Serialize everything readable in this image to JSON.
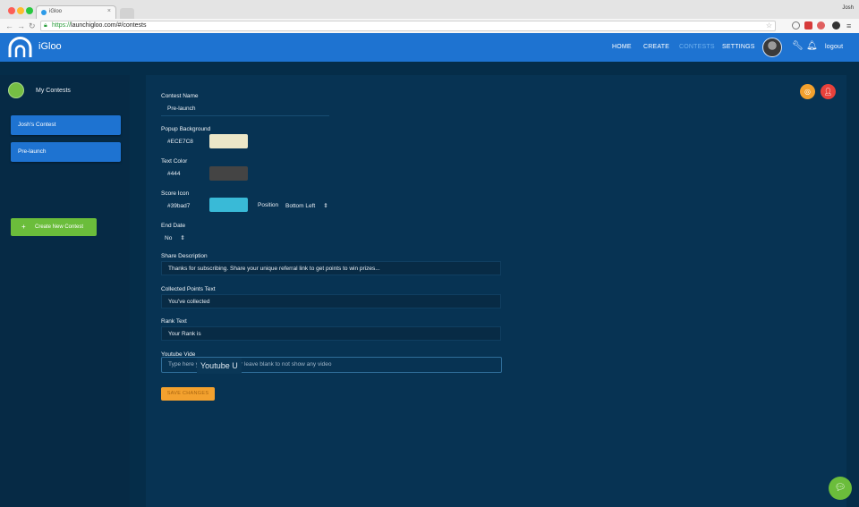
{
  "browser": {
    "tab_title": "iGloo",
    "profile": "Josh",
    "url_scheme": "https://",
    "url_rest": "launchigloo.com/#/contests"
  },
  "topbar": {
    "brand": "iGloo",
    "nav": [
      {
        "label": "HOME"
      },
      {
        "label": "CREATE"
      },
      {
        "label": "CONTESTS"
      },
      {
        "label": "SETTINGS"
      },
      {
        "label": "logout"
      }
    ]
  },
  "sidebar": {
    "title": "My Contests",
    "items": [
      {
        "label": "Josh's Contest"
      },
      {
        "label": "Pre-launch"
      }
    ],
    "create_label": "Create New Contest"
  },
  "form": {
    "contest_name_label": "Contest Name",
    "contest_name_value": "Pre-launch",
    "popup_bg_label": "Popup Background",
    "popup_bg_value": "#ECE7C8",
    "text_color_label": "Text Color",
    "text_color_value": "#444",
    "score_icon_label": "Score Icon",
    "score_icon_value": "#39bad7",
    "position_label": "Position",
    "position_value": "Bottom Left",
    "end_date_label": "End Date",
    "end_date_value": "No",
    "share_desc_label": "Share Description",
    "share_desc_value": "Thanks for subscribing. Share your unique referral link to get points to win prizes...",
    "collected_label": "Collected Points Text",
    "collected_value": "You've collected",
    "rank_label": "Rank Text",
    "rank_value": "Your Rank is",
    "youtube_label": "Youtube Vide",
    "youtube_placeholder": "Type here y",
    "youtube_placeholder_tail": "r leave blank to not show any video",
    "youtube_tooltip": "Youtube U",
    "save_label": "SAVE CHANGES"
  },
  "colors": {
    "popup_bg": "#ECE7C8",
    "text_color": "#444444",
    "score_icon": "#39bad7",
    "accent": "#1e73d1",
    "green": "#6bbd3b",
    "orange": "#f3a12e",
    "red": "#e8413b"
  }
}
